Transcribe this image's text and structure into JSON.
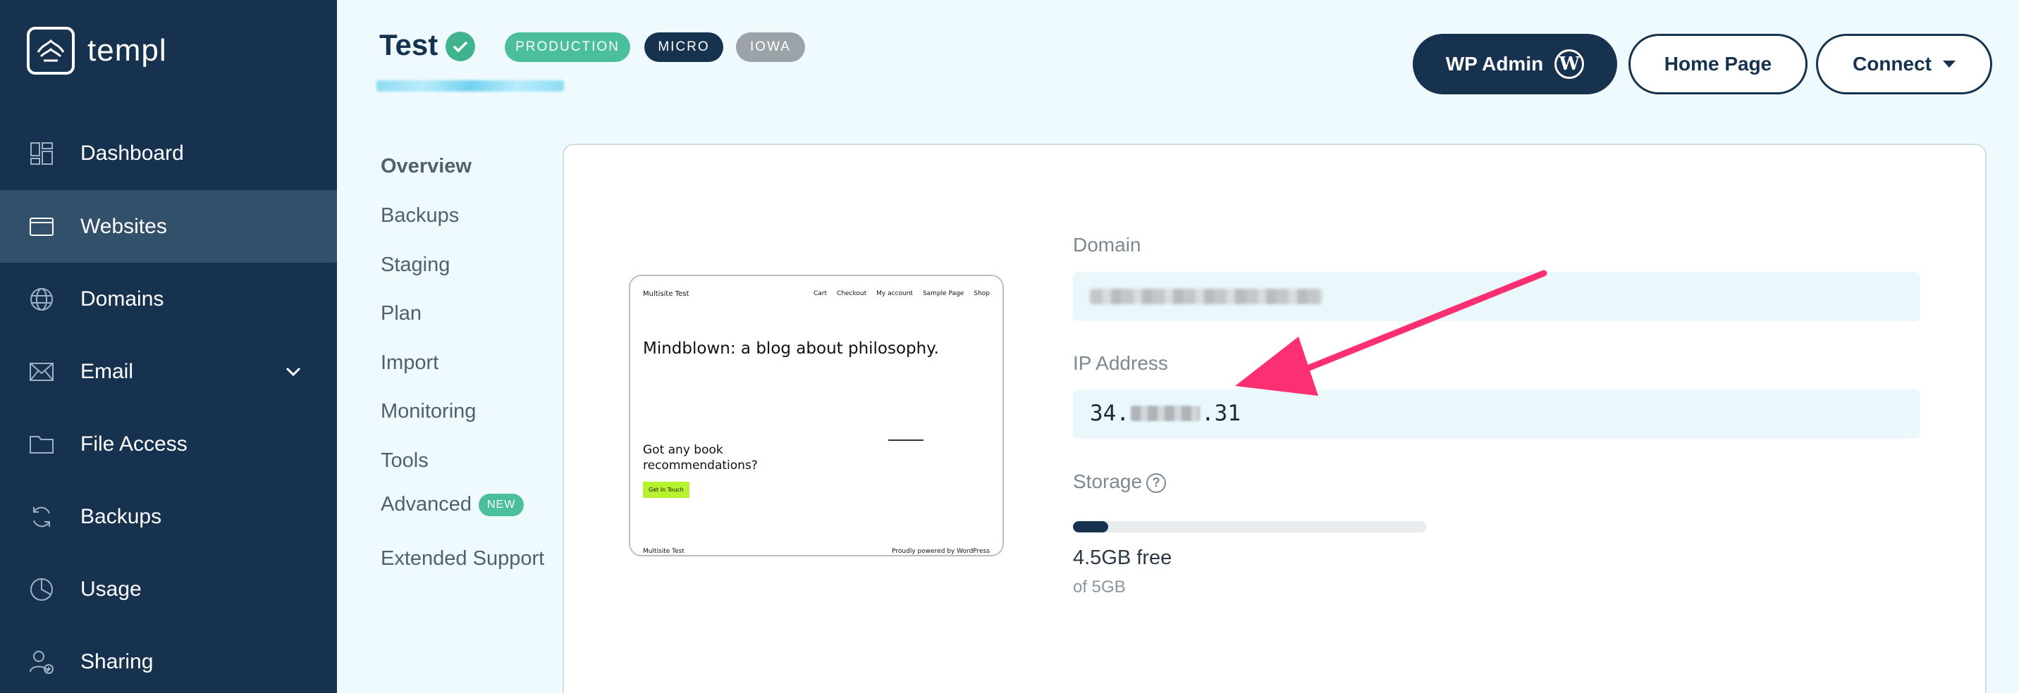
{
  "sidebar": {
    "brand": "templ",
    "items": [
      {
        "label": "Dashboard",
        "icon": "dashboard-icon"
      },
      {
        "label": "Websites",
        "icon": "browser-window-icon",
        "active": true
      },
      {
        "label": "Domains",
        "icon": "globe-icon"
      },
      {
        "label": "Email",
        "icon": "envelope-icon",
        "expandable": true
      },
      {
        "label": "File Access",
        "icon": "folder-icon"
      },
      {
        "label": "Backups",
        "icon": "refresh-icon"
      },
      {
        "label": "Usage",
        "icon": "pie-chart-icon"
      },
      {
        "label": "Sharing",
        "icon": "user-share-icon"
      }
    ]
  },
  "header": {
    "site_name": "Test",
    "tags": [
      "PRODUCTION",
      "MICRO",
      "IOWA"
    ],
    "buttons": {
      "wp_admin": "WP Admin",
      "home_page": "Home Page",
      "connect": "Connect"
    }
  },
  "subnav": [
    {
      "label": "Overview",
      "active": true
    },
    {
      "label": "Backups"
    },
    {
      "label": "Staging"
    },
    {
      "label": "Plan"
    },
    {
      "label": "Import"
    },
    {
      "label": "Monitoring"
    },
    {
      "label": "Tools"
    },
    {
      "label": "Advanced",
      "badge": "NEW"
    },
    {
      "label": "Extended Support"
    }
  ],
  "preview": {
    "site_title": "Multisite Test",
    "menu": [
      "Cart",
      "Checkout",
      "My account",
      "Sample Page",
      "Shop"
    ],
    "headline": "Mindblown: a blog about philosophy.",
    "question": "Got any book recommendations?",
    "cta": "Get In Touch",
    "footer_left": "Multisite Test",
    "footer_right": "Proudly powered by WordPress"
  },
  "details": {
    "domain_label": "Domain",
    "ip_label": "IP Address",
    "ip_prefix": "34.",
    "ip_suffix": ".31",
    "storage_label": "Storage",
    "storage_used_fraction": 0.1,
    "storage_free": "4.5GB free",
    "storage_total": "of 5GB"
  },
  "colors": {
    "sidebar_bg": "#16324f",
    "accent_green": "#4bbf9b",
    "annotation_arrow": "#fb2f72"
  }
}
